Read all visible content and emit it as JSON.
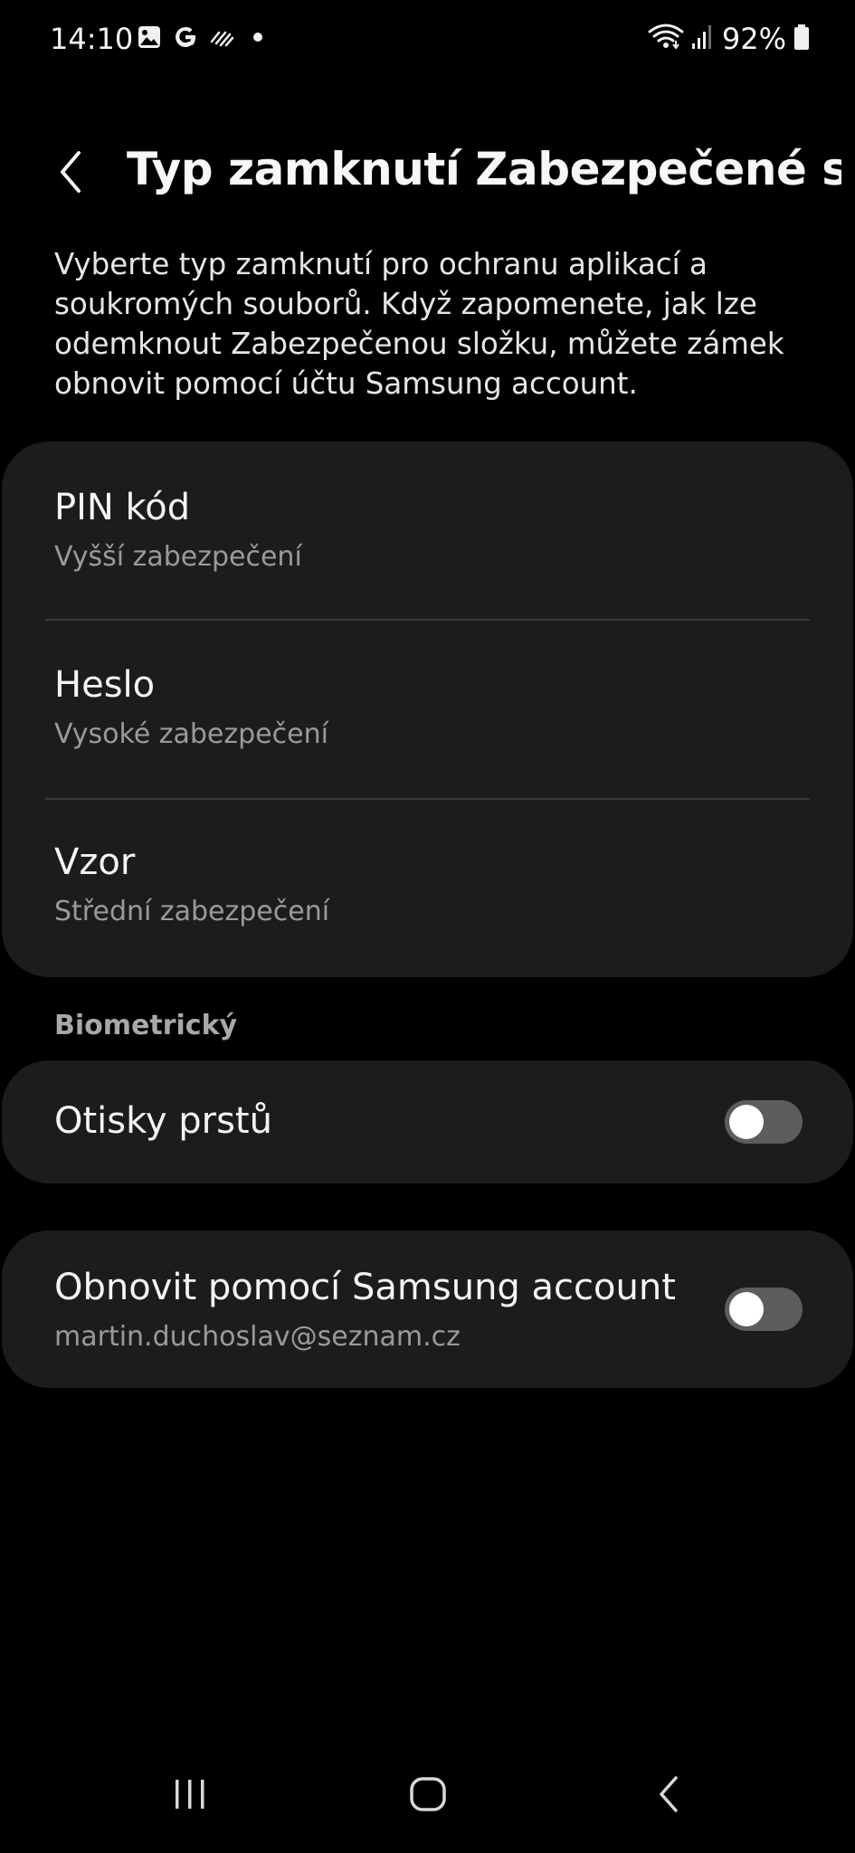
{
  "status_bar": {
    "time": "14:10",
    "battery": "92%",
    "left_icons": [
      "gallery-icon",
      "google-icon",
      "data-saver-icon",
      "dot-icon"
    ],
    "right_icons": [
      "wifi-icon",
      "signal-icon",
      "battery-icon"
    ]
  },
  "header": {
    "title": "Typ zamknutí Zabezpečené slo..."
  },
  "description": "Vyberte typ zamknutí pro ochranu aplikací a soukromých souborů. Když zapomenete, jak lze odemknout Zabezpečenou složku, můžete zámek obnovit pomocí účtu Samsung account.",
  "lock_options": [
    {
      "title": "PIN kód",
      "subtitle": "Vyšší zabezpečení"
    },
    {
      "title": "Heslo",
      "subtitle": "Vysoké zabezpečení"
    },
    {
      "title": "Vzor",
      "subtitle": "Střední zabezpečení"
    }
  ],
  "biometric": {
    "section_label": "Biometrický",
    "fingerprint_label": "Otisky prstů",
    "fingerprint_enabled": false
  },
  "samsung_recovery": {
    "title": "Obnovit pomocí Samsung account",
    "email": "martin.duchoslav@seznam.cz",
    "enabled": false
  },
  "nav_bar": {
    "buttons": [
      "recents-icon",
      "home-icon",
      "back-icon"
    ]
  },
  "colors": {
    "background": "#000000",
    "card": "#1c1c1e",
    "text_primary": "#f5f5f5",
    "text_secondary": "#9a9a9a",
    "toggle_off": "#5d5d60"
  }
}
